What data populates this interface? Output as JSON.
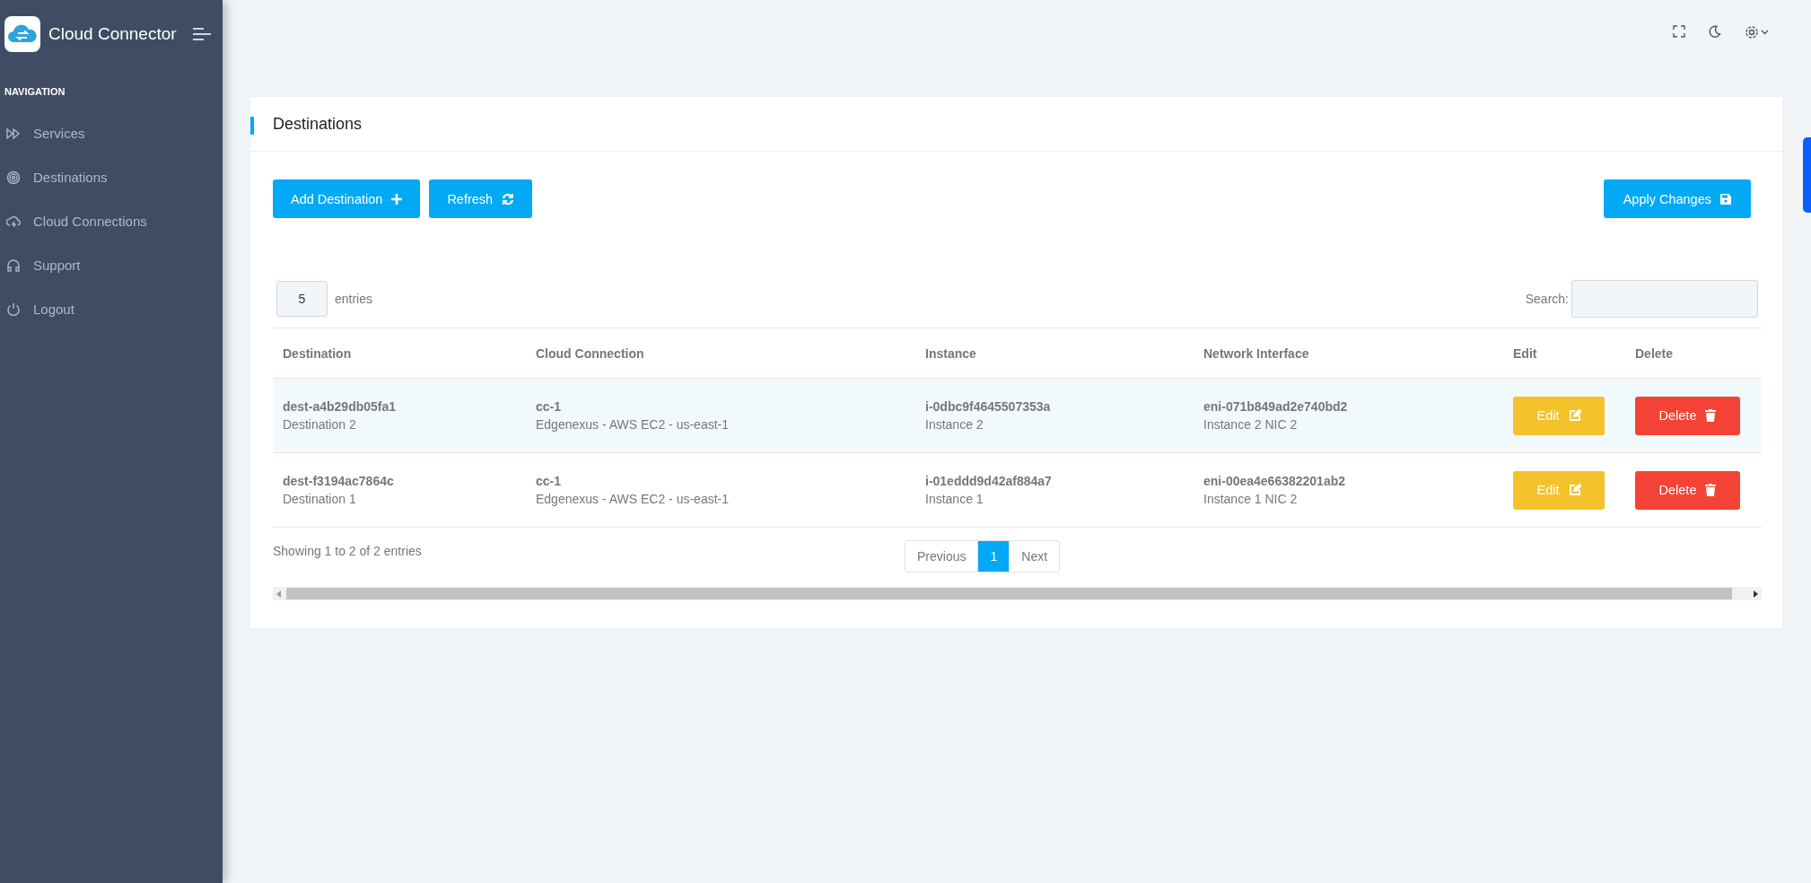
{
  "app": {
    "title": "Cloud Connector"
  },
  "sidebar": {
    "heading": "NAVIGATION",
    "items": [
      {
        "label": "Services"
      },
      {
        "label": "Destinations"
      },
      {
        "label": "Cloud Connections"
      },
      {
        "label": "Support"
      },
      {
        "label": "Logout"
      }
    ]
  },
  "card": {
    "title": "Destinations",
    "buttons": [
      {
        "label": "Add Destination"
      },
      {
        "label": "Refresh"
      }
    ],
    "apply_button": {
      "label": "Apply Changes"
    },
    "page_length": {
      "value": "5",
      "label": "entries"
    },
    "search": {
      "label": "Search:"
    },
    "table": {
      "columns": [
        "Destination",
        "Cloud Connection",
        "Instance",
        "Network Interface",
        "Edit",
        "Delete"
      ],
      "rows": [
        {
          "selected": true,
          "destination": [
            "dest-a4b29db05fa1",
            "Destination 2"
          ],
          "cloud_connection": [
            "cc-1",
            "Edgenexus - AWS EC2 - us-east-1"
          ],
          "instance": [
            "i-0dbc9f4645507353a",
            "Instance 2"
          ],
          "network_interface": [
            "eni-071b849ad2e740bd2",
            "Instance 2 NIC 2"
          ],
          "edit": "Edit",
          "delete": "Delete"
        },
        {
          "selected": false,
          "destination": [
            "dest-f3194ac7864c",
            "Destination 1"
          ],
          "cloud_connection": [
            "cc-1",
            "Edgenexus - AWS EC2 - us-east-1"
          ],
          "instance": [
            "i-01eddd9d42af884a7",
            "Instance 1"
          ],
          "network_interface": [
            "eni-00ea4e66382201ab2",
            "Instance 1 NIC 2"
          ],
          "edit": "Edit",
          "delete": "Delete"
        }
      ]
    },
    "info": "Showing 1 to 2 of 2 entries",
    "pagination": [
      {
        "label": "Previous",
        "selected": false
      },
      {
        "label": "1",
        "selected": true
      },
      {
        "label": "Next",
        "selected": false
      }
    ]
  }
}
